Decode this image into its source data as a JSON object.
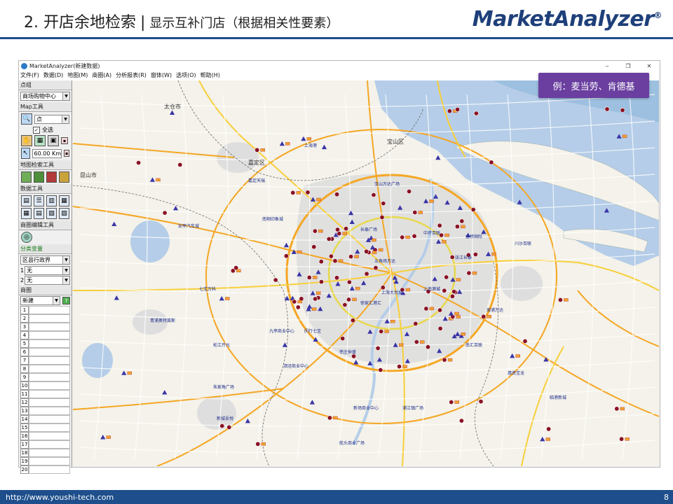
{
  "slide": {
    "title_main": "2. 开店余地检索",
    "title_sep": "|",
    "title_sub": "显示互补门店（根据相关性要素）",
    "logo": "MarketAnalyzer",
    "logo_mark": "®",
    "footer_url": "http://www.youshi-tech.com",
    "page_number": "8"
  },
  "app": {
    "title": "MarketAnalyzer(新建数据)",
    "win_buttons": [
      "‒",
      "❐",
      "✕"
    ],
    "menu": [
      "文件(F)",
      "数据(D)",
      "地图(M)",
      "商圈(A)",
      "分析报表(R)",
      "窗体(W)",
      "选项(O)",
      "帮助(H)"
    ]
  },
  "sidebar": {
    "point_group_label": "点组",
    "point_group_value": "商场购物中心",
    "map_tools_label": "Map工具",
    "point_type": "点",
    "select_all": "全选",
    "distance": "60.00",
    "distance_unit": "Km",
    "map_search_label": "地图检索工具",
    "data_tools_label": "数据工具",
    "trade_edit_label": "商圈编辑工具",
    "category_label": "分类变量",
    "category_value": "区县行政界",
    "var1_index": "1",
    "var1_value": "无",
    "var2_index": "2",
    "var2_value": "无",
    "trade_area_label": "商圈",
    "trade_area_value": "新建",
    "rows": [
      "1",
      "2",
      "3",
      "4",
      "5",
      "6",
      "7",
      "8",
      "9",
      "10",
      "11",
      "12",
      "13",
      "14",
      "15",
      "16",
      "17",
      "18",
      "19",
      "20"
    ]
  },
  "callout": "例：麦当劳、肯德基",
  "map": {
    "districts": [
      "太仓市",
      "宝山区",
      "嘉定区",
      "昆山市"
    ],
    "store_labels": [
      "上海港",
      "宝山万达广场",
      "嘉定天瑞",
      "安亭汽车城",
      "七宝万科",
      "南翔印象城",
      "五角场万达",
      "长泰广场",
      "中环百联",
      "上海大悦城",
      "徐家汇港汇",
      "松江开元",
      "九亭商业中心",
      "闵行七宝",
      "莘庄仲盛",
      "浦江镇广场",
      "金桥国际",
      "川沙百联",
      "周浦万达",
      "惠南宝龙",
      "临港新城",
      "青浦奥特莱斯",
      "朱家角广场",
      "泗泾商业中心",
      "新城吾悦",
      "航头商业广场",
      "新场商业中心",
      "南汇百联",
      "上南港城",
      "张江长泰"
    ],
    "colors": {
      "water": "#b5cde8",
      "urban": "#dedede",
      "land": "#f4f2ea",
      "expressway": "#f5a623",
      "highway": "#f8cf3a",
      "ring": "#e8d84a",
      "boundary": "#6b6b6b",
      "kfc_marker": "#8a1224",
      "mcd_marker": "#3a35a6",
      "label": "#1b2a8a"
    }
  }
}
